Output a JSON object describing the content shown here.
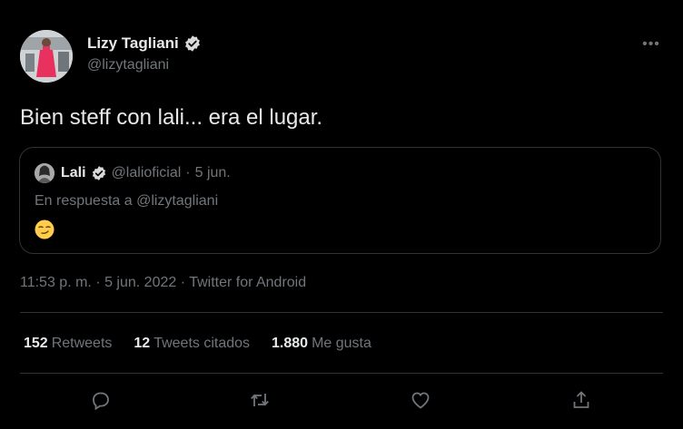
{
  "tweet": {
    "author": {
      "display_name": "Lizy Tagliani",
      "handle": "@lizytagliani",
      "avatar_icon": "avatar-photo-red-dress"
    },
    "text": "Bien steff con lali... era el lugar.",
    "quoted": {
      "author_name": "Lali",
      "handle": "@lalioficial",
      "separator": "·",
      "date": "5 jun.",
      "reply_text": "En respuesta a @lizytagliani",
      "emoji": "😏"
    },
    "timestamp": "11:53 p. m. · 5 jun. 2022 · Twitter for Android",
    "stats": {
      "retweets_count": "152",
      "retweets_label": "Retweets",
      "quotes_count": "12",
      "quotes_label": "Tweets citados",
      "likes_count": "1.880",
      "likes_label": "Me gusta"
    },
    "more_label": "•••"
  },
  "colors": {
    "background": "#000000",
    "text_primary": "#e7e9ea",
    "text_secondary": "#71767b",
    "border": "#2f3336",
    "verified": "#d9d9d9"
  }
}
